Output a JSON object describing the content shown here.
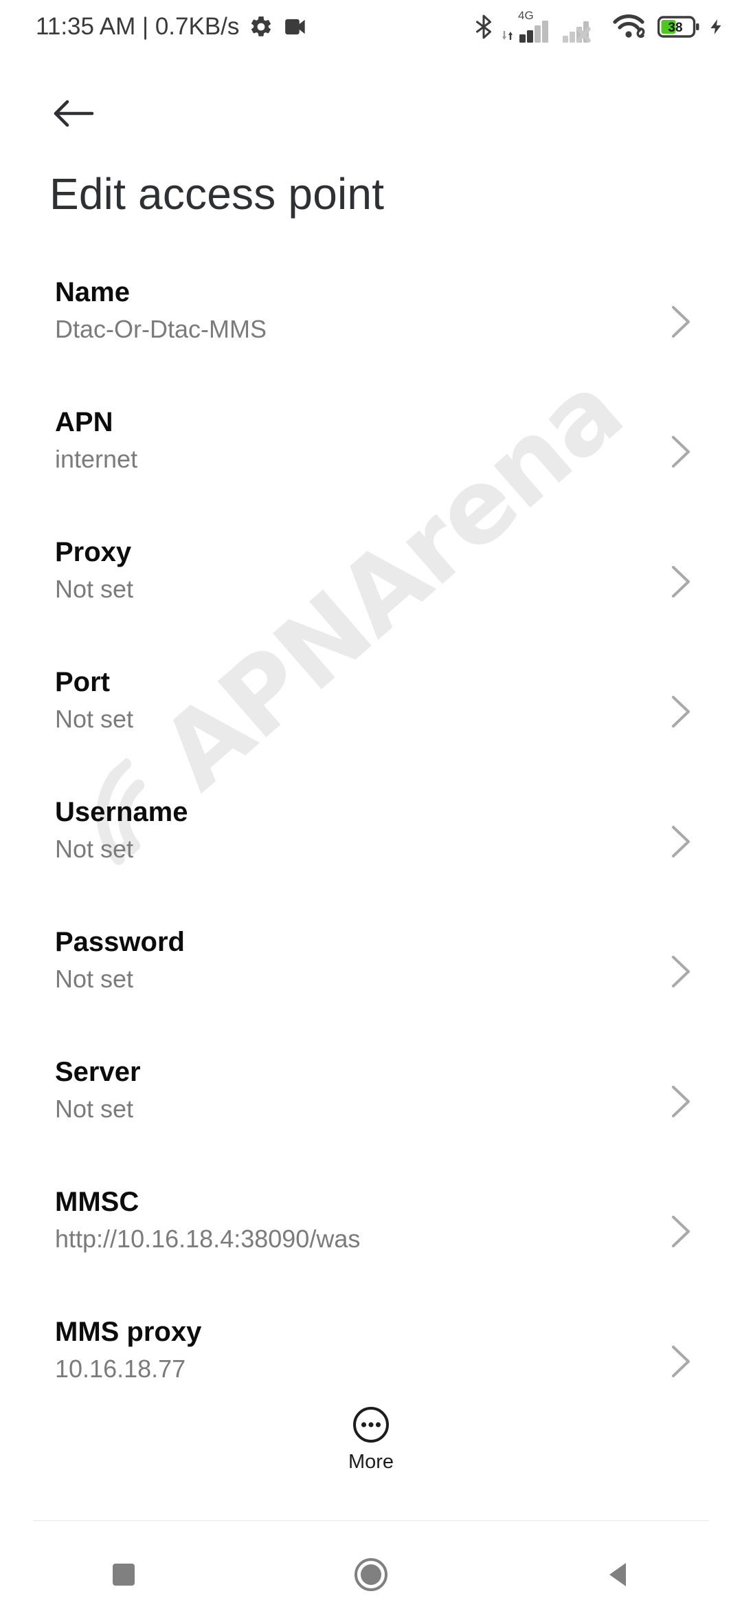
{
  "status_bar": {
    "clock_text": "11:35 AM | 0.7KB/s",
    "network_label": "4G",
    "battery_level": "38",
    "icons": {
      "settings": "gear-icon",
      "screen_record": "camcorder-icon",
      "bluetooth": "bluetooth-icon",
      "sim1_signal": "signal-bars-4g-icon",
      "sim2_signal": "signal-bars-no-service-icon",
      "wifi": "wifi-link-icon",
      "battery": "battery-icon",
      "charging": "charging-bolt-icon"
    },
    "colors": {
      "text": "#3a3a3a",
      "icon_dark": "#3c3c3c",
      "icon_light": "#c4c4c4",
      "battery_green": "#4ec71e"
    }
  },
  "app_bar": {
    "back_icon": "arrow-left-icon",
    "title": "Edit access point"
  },
  "watermark": {
    "text": "APNArena",
    "color": "#eaeaea"
  },
  "settings_list": [
    {
      "label": "Name",
      "value": "Dtac-Or-Dtac-MMS"
    },
    {
      "label": "APN",
      "value": "internet"
    },
    {
      "label": "Proxy",
      "value": "Not set"
    },
    {
      "label": "Port",
      "value": "Not set"
    },
    {
      "label": "Username",
      "value": "Not set"
    },
    {
      "label": "Password",
      "value": "Not set"
    },
    {
      "label": "Server",
      "value": "Not set"
    },
    {
      "label": "MMSC",
      "value": "http://10.16.18.4:38090/was"
    },
    {
      "label": "MMS proxy",
      "value": "10.16.18.77"
    }
  ],
  "more_button": {
    "label": "More",
    "icon": "overflow-dots-circle-icon"
  },
  "nav_bar": {
    "recents": "square-icon",
    "home": "circle-icon",
    "back": "triangle-left-icon",
    "color": "#808080"
  }
}
